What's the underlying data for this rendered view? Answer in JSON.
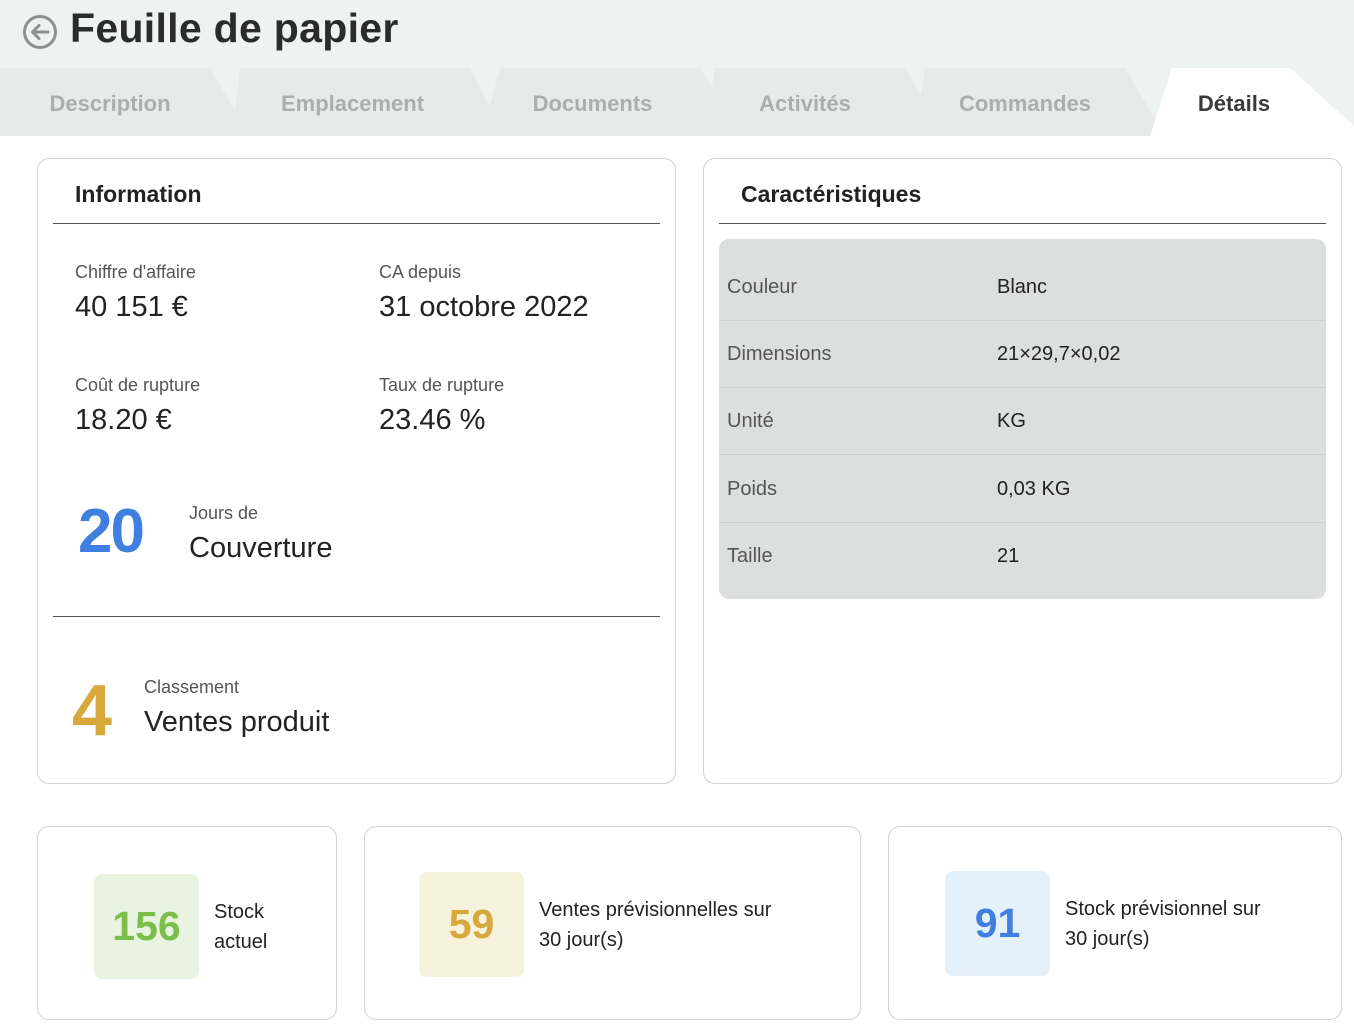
{
  "header": {
    "title": "Feuille de papier",
    "back_icon": "arrow-left-circle-icon"
  },
  "tabs": [
    {
      "label": "Description",
      "active": false
    },
    {
      "label": "Emplacement",
      "active": false
    },
    {
      "label": "Documents",
      "active": false
    },
    {
      "label": "Activités",
      "active": false
    },
    {
      "label": "Commandes",
      "active": false
    },
    {
      "label": "Détails",
      "active": true
    }
  ],
  "information": {
    "title": "Information",
    "revenue": {
      "label": "Chiffre d'affaire",
      "value": "40 151 €"
    },
    "since": {
      "label": "CA depuis",
      "value": "31 octobre 2022"
    },
    "stockout_cost": {
      "label": "Coût de rupture",
      "value": "18.20 €"
    },
    "stockout_rate": {
      "label": "Taux de rupture",
      "value": "23.46 %"
    },
    "coverage": {
      "number": "20",
      "label": "Jours de",
      "value": "Couverture"
    },
    "ranking": {
      "number": "4",
      "label": "Classement",
      "value": "Ventes produit"
    }
  },
  "characteristics": {
    "title": "Caractéristiques",
    "rows": [
      {
        "key": "Couleur",
        "value": "Blanc"
      },
      {
        "key": "Dimensions",
        "value": "21×29,7×0,02"
      },
      {
        "key": "Unité",
        "value": "KG"
      },
      {
        "key": "Poids",
        "value": "0,03 KG"
      },
      {
        "key": "Taille",
        "value": "21"
      }
    ]
  },
  "stats": [
    {
      "value": "156",
      "line1": "Stock",
      "line2": "actuel",
      "color": "#7bbf4a",
      "bg": "#e8f4df"
    },
    {
      "value": "59",
      "line1": "Ventes prévisionnelles sur",
      "line2": "30 jour(s)",
      "color": "#d8a83c",
      "bg": "#f7f2dc"
    },
    {
      "value": "91",
      "line1": "Stock prévisionnel sur",
      "line2": "30 jour(s)",
      "color": "#3f7fe0",
      "bg": "#e4f1fb"
    }
  ],
  "colors": {
    "header_bg": "#eef2f1",
    "accent_blue": "#3f7fe0",
    "accent_gold": "#d8a83c",
    "accent_green": "#7bbf4a"
  }
}
